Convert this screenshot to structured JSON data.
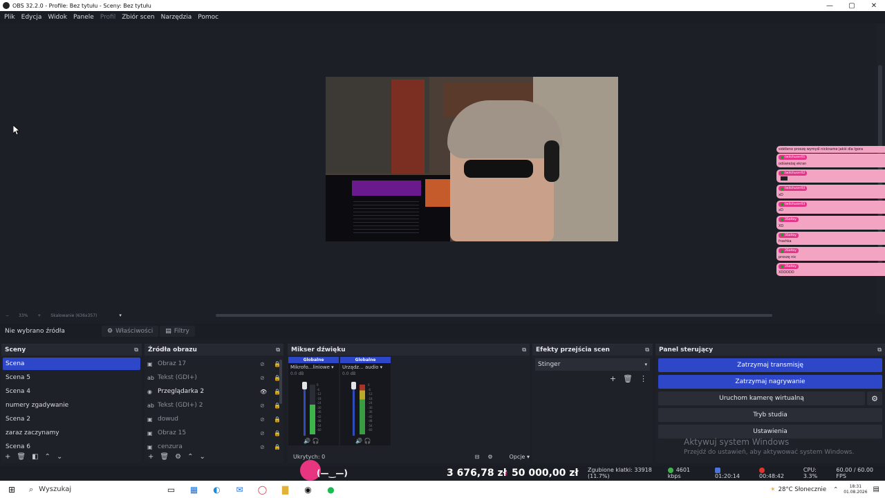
{
  "window": {
    "title": "OBS 32.2.0 - Profile: Bez tytułu - Sceny: Bez tytułu",
    "min": "—",
    "max": "▢",
    "close": "✕"
  },
  "menu": [
    "Plik",
    "Edycja",
    "Widok",
    "Panele",
    "Profil",
    "Zbiór scen",
    "Narzędzia",
    "Pomoc"
  ],
  "zoom": {
    "minus": "−",
    "level": "33%",
    "plus": "+",
    "scale": "Skalowanie (636x357)",
    "caret": "▾"
  },
  "chat": {
    "top": "siddleno proszę wymyśl nickname jakiś dla lgora",
    "messages": [
      {
        "user": "twitchuser01",
        "text": "odświeżaj ekran"
      },
      {
        "user": "twitchuser02",
        "text": ""
      },
      {
        "user": "twitchuser03",
        "text": "xD"
      },
      {
        "user": "twitchuser03",
        "text": "xD"
      },
      {
        "user": "3Saltoy",
        "text": "XD"
      },
      {
        "user": "3Saltoy",
        "text": "frashka"
      },
      {
        "user": "3Saltoy",
        "text": "proszę nic"
      },
      {
        "user": "3Saltoy",
        "text": "XDDDDD"
      }
    ]
  },
  "source_bar": {
    "none_selected": "Nie wybrano źródła",
    "properties": "Właściwości",
    "filters": "Filtry"
  },
  "scenes": {
    "title": "Sceny",
    "items": [
      "Scena",
      "Scena 5",
      "Scena 4",
      "numery zgadywanie",
      "Scena 2",
      "zaraz zaczynamy",
      "Scena 6"
    ],
    "active_index": 0
  },
  "sources": {
    "title": "Źródła obrazu",
    "items": [
      {
        "label": "Obraz 17",
        "icon": "image-icon",
        "visible": false
      },
      {
        "label": "Tekst (GDI+)",
        "icon": "text-icon",
        "visible": false
      },
      {
        "label": "Przeglądarka 2",
        "icon": "browser-icon",
        "visible": true
      },
      {
        "label": "Tekst (GDI+) 2",
        "icon": "text-icon",
        "visible": false
      },
      {
        "label": "dowud",
        "icon": "image-icon",
        "visible": false
      },
      {
        "label": "Obraz 15",
        "icon": "image-icon",
        "visible": false
      },
      {
        "label": "cenzura",
        "icon": "image-icon",
        "visible": false
      }
    ]
  },
  "mixer": {
    "title": "Mikser dźwięku",
    "channels": [
      {
        "badge": "Globalne",
        "name": "Mikrofo...liniowe",
        "db": "0.0 dB"
      },
      {
        "badge": "Globalne",
        "name": "Urządz... audio",
        "db": "0.0 dB"
      }
    ],
    "hidden": "Ukrytych: 0",
    "options": "Opcje"
  },
  "transitions": {
    "title": "Efekty przejścia scen",
    "selected": "Stinger"
  },
  "controls": {
    "title": "Panel sterujący",
    "stop_stream": "Zatrzymaj transmisję",
    "stop_record": "Zatrzymaj nagrywanie",
    "virtual_cam": "Uruchom kamerę wirtualną",
    "studio_mode": "Tryb studia",
    "settings": "Ustawienia"
  },
  "watermark": {
    "line1": "Aktywuj system Windows",
    "line2": "Przejdź do ustawień, aby aktywować system Windows."
  },
  "status": {
    "dropped": "Zgubione klatki: 33918 (11.7%)",
    "bitrate": "4601 kbps",
    "stream_time": "01:20:14",
    "record_time": "00:48:42",
    "cpu": "CPU: 3.3%",
    "fps": "60.00 / 60.00 FPS"
  },
  "donation": {
    "face": "(—‿—)",
    "amount": "3 676,78 zł",
    "sep": "z",
    "goal": "50 000,00 zł"
  },
  "taskbar": {
    "search": "Wyszukaj",
    "weather": "28°C  Słonecznie",
    "time": "18:31",
    "date": "01.08.2026"
  },
  "colors": {
    "accent": "#2e47c9",
    "chat_bg": "#f2a4c2",
    "chat_user": "#e5358a",
    "donation": "#e8357f"
  }
}
